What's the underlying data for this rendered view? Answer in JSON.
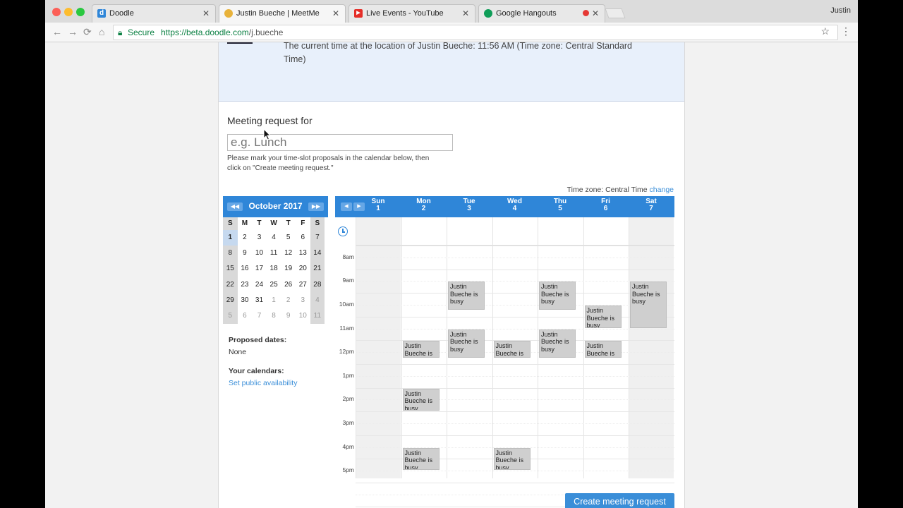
{
  "browser": {
    "tabs": [
      {
        "title": "Doodle",
        "favicon": "d"
      },
      {
        "title": "Justin Bueche | MeetMe",
        "favicon": ""
      },
      {
        "title": "Live Events - YouTube",
        "favicon": "▶"
      },
      {
        "title": "Google Hangouts",
        "favicon": ""
      }
    ],
    "profile_name": "Justin",
    "secure_label": "Secure",
    "url_host": "https://beta.doodle.com",
    "url_path": "/j.bueche"
  },
  "info": {
    "current_time_text": "The current time at the location of Justin Bueche: 11:56 AM (Time zone: Central Standard Time)"
  },
  "request": {
    "label": "Meeting request for",
    "placeholder": "e.g. Lunch",
    "help": "Please mark your time-slot proposals in the calendar below, then click on \"Create meeting request.\"",
    "timezone_label": "Time zone: Central Time",
    "timezone_change": "change"
  },
  "mini_calendar": {
    "title": "October 2017",
    "dows": [
      "S",
      "M",
      "T",
      "W",
      "T",
      "F",
      "S"
    ],
    "weeks": [
      [
        "1",
        "2",
        "3",
        "4",
        "5",
        "6",
        "7"
      ],
      [
        "8",
        "9",
        "10",
        "11",
        "12",
        "13",
        "14"
      ],
      [
        "15",
        "16",
        "17",
        "18",
        "19",
        "20",
        "21"
      ],
      [
        "22",
        "23",
        "24",
        "25",
        "26",
        "27",
        "28"
      ],
      [
        "29",
        "30",
        "31",
        "1",
        "2",
        "3",
        "4"
      ],
      [
        "5",
        "6",
        "7",
        "8",
        "9",
        "10",
        "11"
      ]
    ]
  },
  "sidebar": {
    "proposed_heading": "Proposed dates:",
    "proposed_value": "None",
    "calendars_heading": "Your calendars:",
    "calendars_link": "Set public availability"
  },
  "week": {
    "days": [
      {
        "name": "Sun",
        "date": "1"
      },
      {
        "name": "Mon",
        "date": "2"
      },
      {
        "name": "Tue",
        "date": "3"
      },
      {
        "name": "Wed",
        "date": "4"
      },
      {
        "name": "Thu",
        "date": "5"
      },
      {
        "name": "Fri",
        "date": "6"
      },
      {
        "name": "Sat",
        "date": "7"
      }
    ],
    "hours": [
      "8am",
      "9am",
      "10am",
      "11am",
      "12pm",
      "1pm",
      "2pm",
      "3pm",
      "4pm",
      "5pm"
    ],
    "busy_text": "Justin Bueche is busy",
    "busy_blocks": [
      {
        "day": 2,
        "start": 9.0,
        "end": 10.25
      },
      {
        "day": 4,
        "start": 9.0,
        "end": 10.25
      },
      {
        "day": 6,
        "start": 9.0,
        "end": 11.0
      },
      {
        "day": 5,
        "start": 10.0,
        "end": 11.0
      },
      {
        "day": 2,
        "start": 11.0,
        "end": 12.25
      },
      {
        "day": 4,
        "start": 11.0,
        "end": 12.25
      },
      {
        "day": 1,
        "start": 11.5,
        "end": 12.25
      },
      {
        "day": 3,
        "start": 11.5,
        "end": 12.25
      },
      {
        "day": 5,
        "start": 11.5,
        "end": 12.25
      },
      {
        "day": 1,
        "start": 13.5,
        "end": 14.5
      },
      {
        "day": 1,
        "start": 16.0,
        "end": 17.0
      },
      {
        "day": 3,
        "start": 16.0,
        "end": 17.0
      }
    ]
  },
  "actions": {
    "create_label": "Create meeting request"
  },
  "colors": {
    "accent": "#2f86d8",
    "link": "#3a8ed8",
    "busy": "#cfcfcf"
  }
}
